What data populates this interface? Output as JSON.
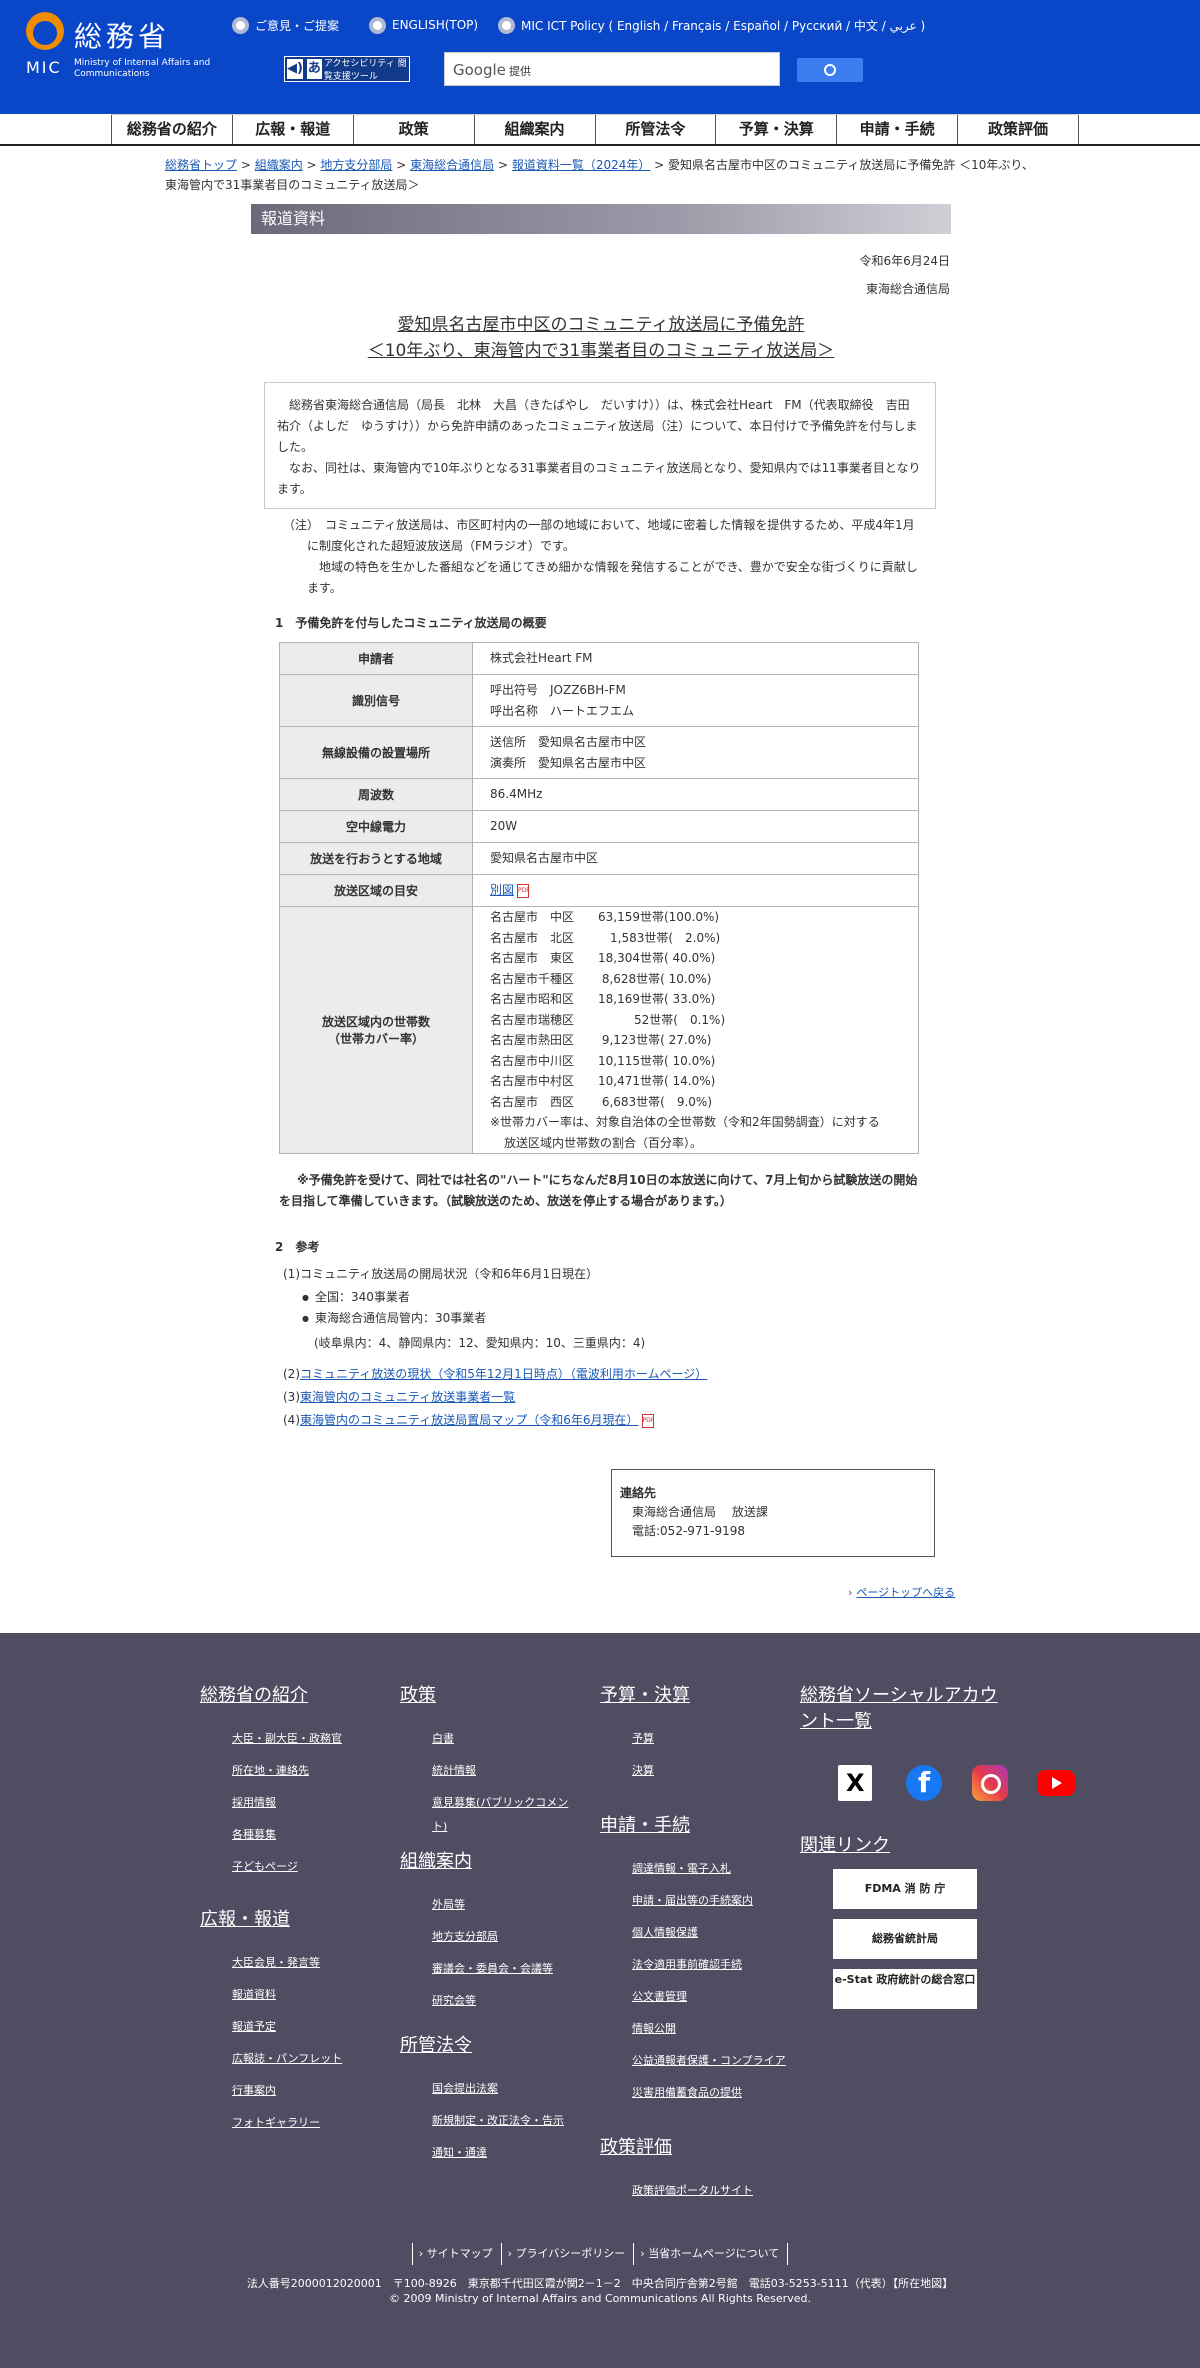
{
  "header": {
    "logo_jp": "総務省",
    "logo_abbr": "MIC",
    "logo_en": "Ministry of Internal Affairs and Communications",
    "radios": [
      "ご意見・ご提案",
      "ENGLISH(TOP)",
      "MIC ICT Policy ( English / Français / Español / Русский / 中文 / عربي )"
    ],
    "accessibility_label": "アクセシビリティ 閲覧支援ツール",
    "search": {
      "brand": "Google",
      "placeholder": "提供"
    }
  },
  "gnav": [
    "総務省の紹介",
    "広報・報道",
    "政策",
    "組織案内",
    "所管法令",
    "予算・決算",
    "申請・手続",
    "政策評価"
  ],
  "breadcrumb": {
    "links": [
      "総務省トップ",
      "組織案内",
      "地方支分部局",
      "東海総合通信局",
      "報道資料一覧（2024年）"
    ],
    "current": "愛知県名古屋市中区のコミュニティ放送局に予備免許 ＜10年ぶり、東海管内で31事業者目のコミュニティ放送局＞"
  },
  "press": {
    "section_label": "報道資料",
    "date": "令和6年6月24日",
    "issuer": "東海総合通信局",
    "title_line1": "愛知県名古屋市中区のコミュニティ放送局に予備免許",
    "title_line2": "＜10年ぶり、東海管内で31事業者目のコミュニティ放送局＞",
    "summary_p1": "総務省東海総合通信局（局長　北林　大昌（きたばやし　だいすけ））は、株式会社Heart　FM（代表取締役　吉田　祐介（よしだ　ゆうすけ））から免許申請のあったコミュニティ放送局（注）について、本日付けで予備免許を付与しました。",
    "summary_p2": "なお、同社は、東海管内で10年ぶりとなる31事業者目のコミュニティ放送局となり、愛知県内では11事業者目となります。",
    "note_p1": "（注）　コミュニティ放送局は、市区町村内の一部の地域において、地域に密着した情報を提供するため、平成4年1月に制度化された超短波放送局（FMラジオ）です。",
    "note_p2": "地域の特色を生かした番組などを通じてきめ細かな情報を発信することができ、豊かで安全な街づくりに貢献します。",
    "section1_heading": "1　予備免許を付与したコミュニティ放送局の概要",
    "table": {
      "applicant_label": "申請者",
      "applicant": "株式会社Heart FM",
      "callsign_label": "識別信号",
      "callsign_1": "呼出符号　JOZZ6BH-FM",
      "callsign_2": "呼出名称　ハートエフエム",
      "location_label": "無線設備の設置場所",
      "location_1": "送信所　愛知県名古屋市中区",
      "location_2": "演奏所　愛知県名古屋市中区",
      "freq_label": "周波数",
      "freq": "86.4MHz",
      "power_label": "空中線電力",
      "power": "20W",
      "area_label": "放送を行おうとする地域",
      "area": "愛知県名古屋市中区",
      "guide_label": "放送区域の目安",
      "guide_link": "別図",
      "households_label_1": "放送区域内の世帯数",
      "households_label_2": "（世帯カバー率）",
      "households": [
        "名古屋市　中区　　63,159世帯(100.0%)",
        "名古屋市　北区　　　1,583世帯(　2.0%)",
        "名古屋市　東区　　18,304世帯( 40.0%)",
        "名古屋市千種区　　 8,628世帯( 10.0%)",
        "名古屋市昭和区　　18,169世帯( 33.0%)",
        "名古屋市瑞穂区　　　　　52世帯(　0.1%)",
        "名古屋市熱田区　　 9,123世帯( 27.0%)",
        "名古屋市中川区　　10,115世帯( 10.0%)",
        "名古屋市中村区　　10,471世帯( 14.0%)",
        "名古屋市　西区　　 6,683世帯(　9.0%)"
      ],
      "households_note_1": "※世帯カバー率は、対象自治体の全世帯数（令和2年国勢調査）に対する",
      "households_note_2": "放送区域内世帯数の割合（百分率）。"
    },
    "bold_note": "※予備免許を受けて、同社では社名の\"ハート\"にちなんだ8月10日の本放送に向けて、7月上旬から試験放送の開始を目指して準備していきます。（試験放送のため、放送を停止する場合があります。）",
    "section2_heading": "2　参考",
    "ref_1": "(1)コミュニティ放送局の開局状況（令和6年6月1日現在）",
    "ref_1_items": [
      "全国：340事業者",
      "東海総合通信局管内：30事業者"
    ],
    "ref_1_sub": "(岐阜県内：4、静岡県内：12、愛知県内：10、三重県内：4)",
    "ref_links": [
      {
        "num": "(2)",
        "text": "コミュニティ放送の現状（令和5年12月1日時点）（電波利用ホームページ）"
      },
      {
        "num": "(3)",
        "text": "東海管内のコミュニティ放送事業者一覧"
      },
      {
        "num": "(4)",
        "text": "東海管内のコミュニティ放送局置局マップ（令和6年6月現在）"
      }
    ],
    "contact": {
      "heading": "連絡先",
      "dept": "東海総合通信局　 放送課",
      "tel": "電話:052-971-9198"
    },
    "pagetop": "ページトップへ戻る"
  },
  "footer": {
    "col1": [
      {
        "h": "総務省の紹介",
        "links": [
          "大臣・副大臣・政務官",
          "所在地・連絡先",
          "採用情報",
          "各種募集",
          "子どもページ"
        ]
      },
      {
        "h": "広報・報道",
        "links": [
          "大臣会見・発言等",
          "報道資料",
          "報道予定",
          "広報誌・パンフレット",
          "行事案内",
          "フォトギャラリー"
        ]
      }
    ],
    "col2": [
      {
        "h": "政策",
        "links": [
          "白書",
          "統計情報",
          "意見募集(パブリックコメント)"
        ]
      },
      {
        "h": "組織案内",
        "links": [
          "外局等",
          "地方支分部局",
          "審議会・委員会・会議等",
          "研究会等"
        ]
      },
      {
        "h": "所管法令",
        "links": [
          "国会提出法案",
          "新規制定・改正法令・告示",
          "通知・通達"
        ]
      }
    ],
    "col3": [
      {
        "h": "予算・決算",
        "links": [
          "予算",
          "決算"
        ]
      },
      {
        "h": "申請・手続",
        "links": [
          "調達情報・電子入札",
          "申請・届出等の手続案内",
          "個人情報保護",
          "法令適用事前確認手続",
          "公文書管理",
          "情報公開",
          "公益通報者保護・コンプライア",
          "災害用備蓄食品の提供"
        ]
      },
      {
        "h": "政策評価",
        "links": [
          "政策評価ポータルサイト"
        ]
      }
    ],
    "social_heading_1": "総務省ソーシャルアカウ",
    "social_heading_2": "ント一覧",
    "related_heading": "関連リンク",
    "banners": [
      "FDMA 消 防 庁",
      "総務省統計局",
      "e-Stat 政府統計の総合窓口"
    ],
    "bottom_links": [
      "サイトマップ",
      "プライバシーポリシー",
      "当省ホームページについて"
    ],
    "address": "法人番号2000012020001　〒100-8926　東京都千代田区霞が関2－1－2　中央合同庁舎第2号館　電話03-5253-5111（代表）【所在地図】",
    "copyright": "© 2009 Ministry of Internal Affairs and Communications All Rights Reserved."
  }
}
